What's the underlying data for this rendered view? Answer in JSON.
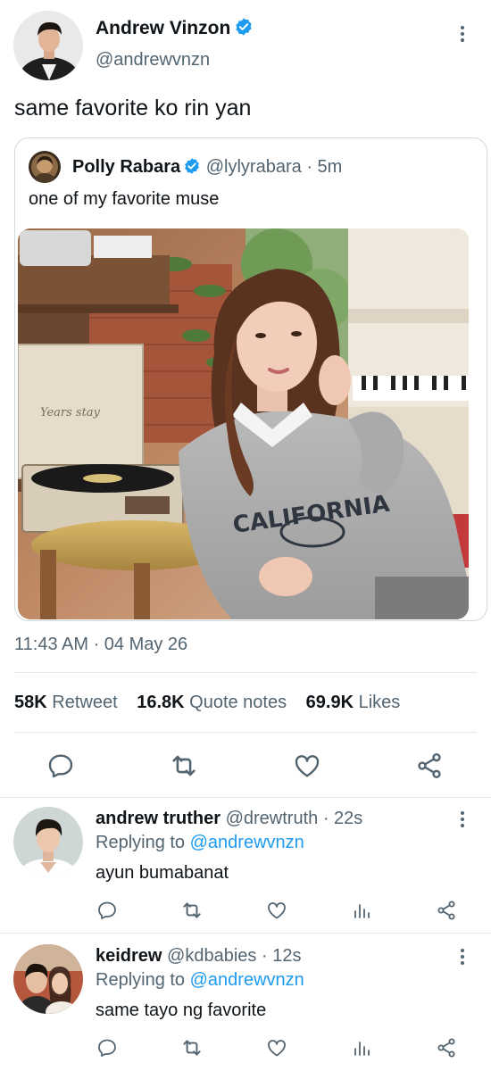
{
  "main_tweet": {
    "author_name": "Andrew Vinzon",
    "author_handle": "@andrewvnzn",
    "text": "same favorite ko rin yan",
    "timestamp": "11:43 AM · 04 May 26",
    "stats": {
      "retweets": "58K",
      "retweets_label": "Retweet",
      "quotes": "16.8K",
      "quotes_label": "Quote notes",
      "likes": "69.9K",
      "likes_label": "Likes"
    }
  },
  "quoted_tweet": {
    "author_name": "Polly Rabara",
    "author_handle": "@lylyrabara",
    "separator": "·",
    "time": "5m",
    "text": "one of my favorite muse",
    "image_text": {
      "sweater": "CALIFORNIA",
      "box": "Years stay"
    }
  },
  "replies": [
    {
      "author_name": "andrew truther",
      "author_handle": "@drewtruth",
      "time_meta": " · 22s",
      "replying_prefix": "Replying to ",
      "replying_to": "@andrewvnzn",
      "text": "ayun bumabanat"
    },
    {
      "author_name": "keidrew",
      "author_handle": "@kdbabies",
      "time_meta": " · 12s",
      "replying_prefix": "Replying to ",
      "replying_to": "@andrewvnzn",
      "text": "same tayo ng favorite"
    }
  ],
  "icons": {
    "reply": "reply-icon",
    "retweet": "retweet-icon",
    "like": "heart-icon",
    "share": "share-icon",
    "analytics": "analytics-icon",
    "more": "more-icon",
    "verified": "verified-badge-icon"
  },
  "colors": {
    "accent": "#1d9bf0",
    "secondary_text": "#536471",
    "primary_text": "#0f1419",
    "divider": "#e1e8ed"
  }
}
